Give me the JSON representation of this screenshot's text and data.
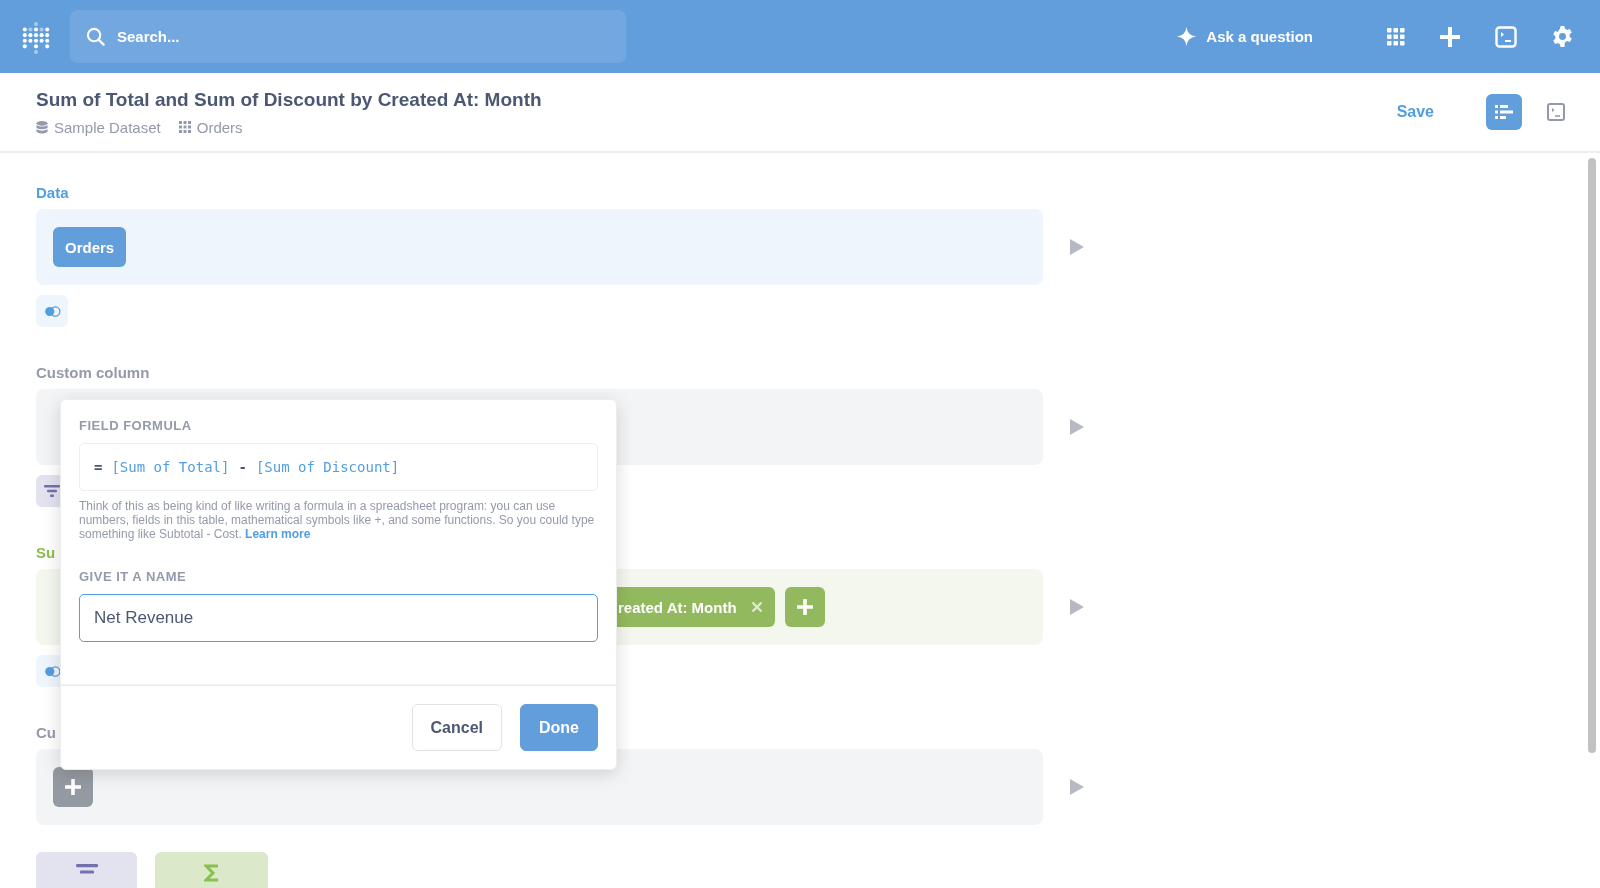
{
  "topbar": {
    "search": {
      "placeholder": "Search..."
    },
    "ask_button": "Ask a question"
  },
  "header": {
    "title": "Sum of Total and Sum of Discount by Created At: Month",
    "breadcrumbs": [
      {
        "kind": "database",
        "label": "Sample Dataset"
      },
      {
        "kind": "table",
        "label": "Orders"
      }
    ],
    "save": "Save",
    "view_toggles": [
      {
        "kind": "editor",
        "selected": true
      },
      {
        "kind": "sql",
        "selected": false
      }
    ]
  },
  "steps": [
    {
      "kind": "data",
      "label": "Data",
      "chips": [
        {
          "label": "Orders",
          "removable": false
        }
      ],
      "add_button": false,
      "actions": [
        {
          "kind": "join"
        }
      ]
    },
    {
      "kind": "custom",
      "label": "Custom column",
      "add_button": false,
      "actions": [
        {
          "kind": "filter"
        }
      ]
    },
    {
      "kind": "summarize",
      "label": "Su",
      "chips": [
        {
          "label": "reated At: Month",
          "removable": true
        }
      ],
      "add_button": true,
      "actions": [
        {
          "kind": "join"
        }
      ]
    },
    {
      "kind": "custom",
      "label": "Cu",
      "add_button": true
    }
  ],
  "bottom_actions": [
    {
      "kind": "filter"
    },
    {
      "kind": "summarize"
    }
  ],
  "popover": {
    "title": "FIELD FORMULA",
    "formula": [
      {
        "kind": "op",
        "text": "="
      },
      {
        "kind": "field",
        "text": "[Sum of Total]"
      },
      {
        "kind": "op",
        "text": "-"
      },
      {
        "kind": "field",
        "text": "[Sum of Discount]"
      }
    ],
    "help": "Think of this as being kind of like writing a formula in a spreadsheet program: you can use numbers, fields in this table, mathematical symbols like +, and some functions. So you could type something like Subtotal - Cost.",
    "help_link": "Learn more",
    "name_label": "GIVE IT A NAME",
    "name_value": "Net Revenue",
    "buttons": [
      {
        "kind": "secondary",
        "label": "Cancel"
      },
      {
        "kind": "primary",
        "label": "Done"
      }
    ]
  }
}
